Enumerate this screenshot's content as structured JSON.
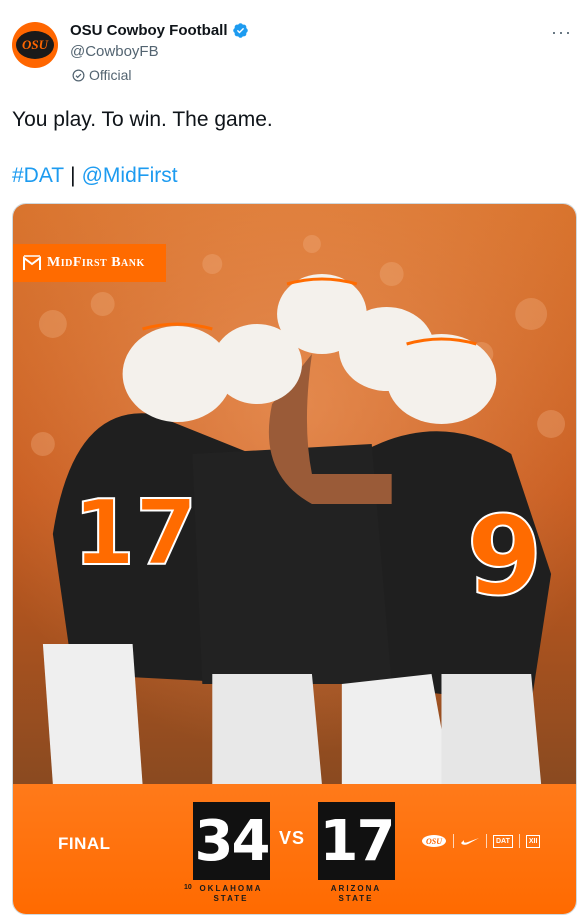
{
  "tweet": {
    "display_name": "OSU Cowboy Football",
    "handle": "@CowboyFB",
    "badge_label": "Official",
    "avatar_text": "OSU",
    "text": "You play. To win. The game.",
    "hashtag": "#DAT",
    "separator": "|",
    "mention": "@MidFirst",
    "more_label": "···"
  },
  "media": {
    "sponsor": "MidFirst Bank",
    "final_label": "FINAL",
    "vs_label": "VS",
    "home": {
      "score": "34",
      "name_line1": "OKLAHOMA",
      "name_line2": "STATE",
      "rank": "10"
    },
    "away": {
      "score": "17",
      "name_line1": "ARIZONA",
      "name_line2": "STATE"
    },
    "logo_items": [
      "OSU",
      "swoosh",
      "DAT",
      "XII"
    ]
  },
  "colors": {
    "brand_orange": "#ff6600",
    "link_blue": "#1d9bf0",
    "verified_blue": "#1d9bf0",
    "text_primary": "#0f1419",
    "text_secondary": "#536471"
  },
  "icons": {
    "verified": "verified-badge-icon",
    "official": "official-check-icon",
    "more": "more-options-icon"
  }
}
